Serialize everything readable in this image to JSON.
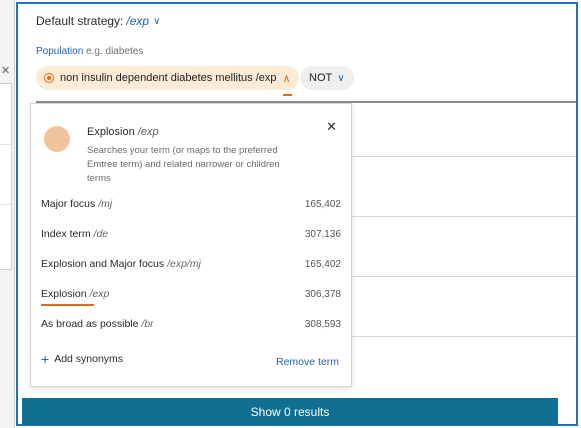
{
  "header": {
    "strategy_label": "Default strategy:",
    "strategy_value": "/exp",
    "population_label": "Population",
    "population_hint": "e.g. diabetes"
  },
  "term_chip": {
    "text": "non insulin dependent diabetes mellitus /exp"
  },
  "not_chip": {
    "label": "NOT"
  },
  "popup": {
    "title": "Explosion",
    "title_code": "/exp",
    "description": "Searches your term (or maps to the preferred Emtree term) and related narrower or children terms",
    "options": [
      {
        "label": "Major focus",
        "code": "/mj",
        "count": "165,402"
      },
      {
        "label": "Index term",
        "code": "/de",
        "count": "307,136"
      },
      {
        "label": "Explosion and Major focus",
        "code": "/exp/mj",
        "count": "165,402"
      },
      {
        "label": "Explosion",
        "code": "/exp",
        "count": "306,378"
      },
      {
        "label": "As broad as possible",
        "code": "/br",
        "count": "308,593"
      }
    ],
    "add_synonyms": "Add synonyms",
    "remove_term": "Remove term"
  },
  "footer": {
    "show_results": "Show 0 results"
  },
  "colors": {
    "accent_blue": "#1e73be",
    "link_blue": "#1e63b0",
    "orange": "#e06b0d",
    "chip_bg": "#fdebd8",
    "button_bg": "#0f6f90"
  }
}
